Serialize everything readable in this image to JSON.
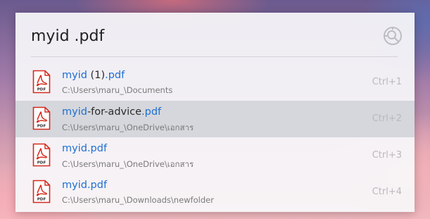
{
  "search": {
    "query": "myid .pdf"
  },
  "icons": {
    "search": "search-icon",
    "file": "pdf-file-icon",
    "file_label": "PDF"
  },
  "colors": {
    "highlight": "#1f6fd1",
    "pdf_red": "#d42b1e",
    "selected_row": "#c8ccd2"
  },
  "results": [
    {
      "title_parts": [
        {
          "text": "myid",
          "highlight": true
        },
        {
          "text": " (1)",
          "highlight": false
        },
        {
          "text": ".pdf",
          "highlight": true
        }
      ],
      "path": "C:\\Users\\maru_\\Documents",
      "shortcut": "Ctrl+1",
      "selected": false
    },
    {
      "title_parts": [
        {
          "text": "myid",
          "highlight": true
        },
        {
          "text": "-for-advice",
          "highlight": false
        },
        {
          "text": ".pdf",
          "highlight": true
        }
      ],
      "path": "C:\\Users\\maru_\\OneDrive\\เอกสาร",
      "shortcut": "Ctrl+2",
      "selected": true
    },
    {
      "title_parts": [
        {
          "text": "myid.pdf",
          "highlight": true
        }
      ],
      "path": "C:\\Users\\maru_\\OneDrive\\เอกสาร",
      "shortcut": "Ctrl+3",
      "selected": false
    },
    {
      "title_parts": [
        {
          "text": "myid.pdf",
          "highlight": true
        }
      ],
      "path": "C:\\Users\\maru_\\Downloads\\newfolder",
      "shortcut": "Ctrl+4",
      "selected": false
    }
  ]
}
